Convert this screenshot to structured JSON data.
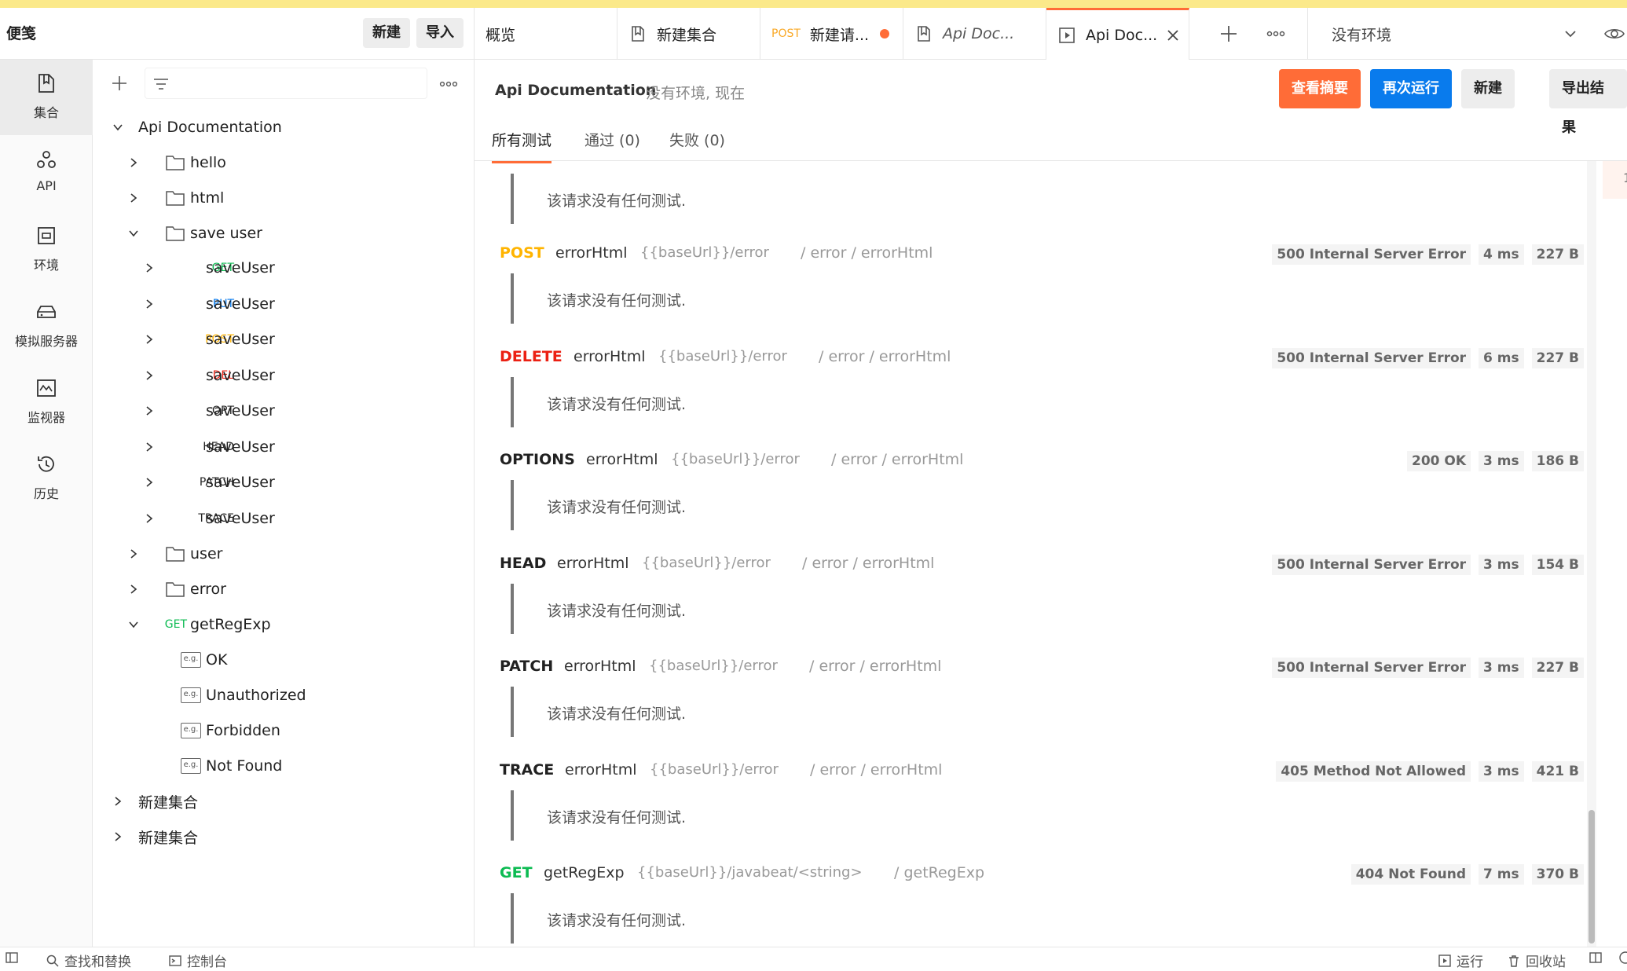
{
  "app": {
    "workspace": "便笺"
  },
  "header": {
    "new_label": "新建",
    "import_label": "导入",
    "tabs": [
      {
        "label": "概览"
      },
      {
        "label": "新建集合"
      },
      {
        "method": "POST",
        "label": "新建请..."
      },
      {
        "label": "Api Doc..."
      },
      {
        "label": "Api Doc..."
      }
    ],
    "environment": "没有环境"
  },
  "nav": {
    "items": [
      {
        "label": "集合",
        "icon": "collection-icon"
      },
      {
        "label": "API",
        "icon": "api-icon"
      },
      {
        "label": "环境",
        "icon": "environment-icon"
      },
      {
        "label": "模拟服务器",
        "icon": "mock-server-icon"
      },
      {
        "label": "监视器",
        "icon": "monitor-icon"
      },
      {
        "label": "历史",
        "icon": "history-icon"
      }
    ]
  },
  "sidebar": {
    "collection": "Api Documentation",
    "folders": {
      "hello": "hello",
      "html": "html",
      "save_user": "save user",
      "user": "user",
      "error": "error"
    },
    "save_user_requests": [
      {
        "method": "GET",
        "name": "saveUser",
        "color": "#0cbb52"
      },
      {
        "method": "PUT",
        "name": "saveUser",
        "color": "#097bed"
      },
      {
        "method": "POST",
        "name": "saveUser",
        "color": "#ffb400"
      },
      {
        "method": "DEL",
        "name": "saveUser",
        "color": "#eb2013"
      },
      {
        "method": "OPT",
        "name": "saveUser",
        "color": "#212121"
      },
      {
        "method": "HEAD",
        "name": "saveUser",
        "color": "#212121"
      },
      {
        "method": "PATCH",
        "name": "saveUser",
        "color": "#212121"
      },
      {
        "method": "TRACE",
        "name": "saveUser",
        "color": "#212121"
      }
    ],
    "getregexp": {
      "method": "GET",
      "name": "getRegExp"
    },
    "examples": [
      "OK",
      "Unauthorized",
      "Forbidden",
      "Not Found"
    ],
    "other_collections": [
      "新建集合",
      "新建集合"
    ]
  },
  "main": {
    "title": "Api Documentation",
    "subtitle": "没有环境, 现在",
    "buttons": {
      "summary": "查看摘要",
      "rerun": "再次运行",
      "new": "新建",
      "export": "导出结果"
    },
    "tabs": {
      "all": "所有测试",
      "passed": "通过 (0)",
      "failed": "失败 (0)"
    },
    "no_tests_text": "该请求没有任何测试.",
    "requests": [
      {
        "method": "POST",
        "color": "#ffb400",
        "name": "errorHtml",
        "url": "{{baseUrl}}/error",
        "path": "/ error / errorHtml",
        "status": "500 Internal Server Error",
        "time": "4 ms",
        "size": "227 B"
      },
      {
        "method": "DELETE",
        "color": "#eb2013",
        "name": "errorHtml",
        "url": "{{baseUrl}}/error",
        "path": "/ error / errorHtml",
        "status": "500 Internal Server Error",
        "time": "6 ms",
        "size": "227 B"
      },
      {
        "method": "OPTIONS",
        "color": "#212121",
        "name": "errorHtml",
        "url": "{{baseUrl}}/error",
        "path": "/ error / errorHtml",
        "status": "200 OK",
        "time": "3 ms",
        "size": "186 B"
      },
      {
        "method": "HEAD",
        "color": "#212121",
        "name": "errorHtml",
        "url": "{{baseUrl}}/error",
        "path": "/ error / errorHtml",
        "status": "500 Internal Server Error",
        "time": "3 ms",
        "size": "154 B"
      },
      {
        "method": "PATCH",
        "color": "#212121",
        "name": "errorHtml",
        "url": "{{baseUrl}}/error",
        "path": "/ error / errorHtml",
        "status": "500 Internal Server Error",
        "time": "3 ms",
        "size": "227 B"
      },
      {
        "method": "TRACE",
        "color": "#212121",
        "name": "errorHtml",
        "url": "{{baseUrl}}/error",
        "path": "/ error / errorHtml",
        "status": "405 Method Not Allowed",
        "time": "3 ms",
        "size": "421 B"
      },
      {
        "method": "GET",
        "color": "#0cbb52",
        "name": "getRegExp",
        "url": "{{baseUrl}}/javabeat/<string>",
        "path": "/ getRegExp",
        "status": "404 Not Found",
        "time": "7 ms",
        "size": "370 B"
      }
    ],
    "edge_marker": "1"
  },
  "statusbar": {
    "find_replace": "查找和替换",
    "console": "控制台",
    "runner": "运行",
    "trash": "回收站"
  },
  "colors": {
    "accent": "#ff6c37",
    "primary": "#097bed"
  }
}
